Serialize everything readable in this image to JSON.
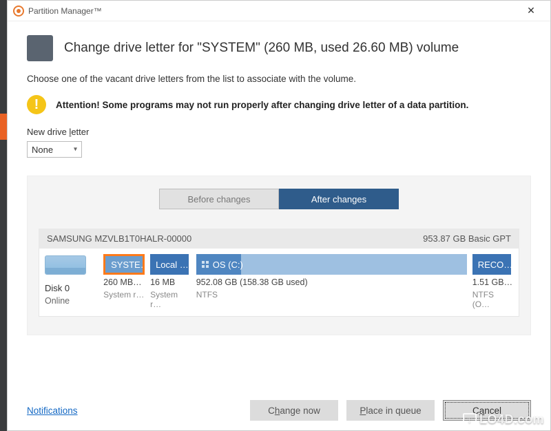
{
  "window": {
    "title": "Partition Manager™",
    "close_glyph": "✕"
  },
  "heading": "Change drive letter for \"SYSTEM\" (260 MB, used 26.60 MB) volume",
  "subheading": "Choose one of the vacant drive letters from the list to associate with the volume.",
  "attention": {
    "icon_glyph": "!",
    "text": "Attention! Some programs may not run properly after changing drive letter of a data partition."
  },
  "field": {
    "label_prefix": "New drive ",
    "label_underlined": "l",
    "label_suffix": "etter",
    "value": "None"
  },
  "tabs": {
    "before": "Before changes",
    "after": "After changes"
  },
  "disk_header": {
    "name": "SAMSUNG MZVLB1T0HALR-00000",
    "info": "953.87 GB Basic GPT"
  },
  "disk": {
    "label": "Disk 0",
    "status": "Online"
  },
  "partitions": {
    "system": {
      "label": "SYSTE…",
      "size": "260 MB…",
      "fs": "System r…"
    },
    "local": {
      "label": "Local …",
      "size": "16 MB",
      "fs": "System r…"
    },
    "os": {
      "label": "OS (C:)",
      "size": "952.08 GB (158.38 GB used)",
      "fs": "NTFS"
    },
    "reco": {
      "label": "RECO…",
      "size": "1.51 GB…",
      "fs": "NTFS (O…"
    }
  },
  "footer": {
    "notifications": "Notifications",
    "change_pre": "C",
    "change_u": "h",
    "change_post": "ange now",
    "queue_pre": "",
    "queue_u": "P",
    "queue_post": "lace in queue",
    "cancel_pre": "C",
    "cancel_u": "a",
    "cancel_post": "ncel"
  },
  "watermark": {
    "arrow": "↓",
    "text": "LO4D.com"
  }
}
